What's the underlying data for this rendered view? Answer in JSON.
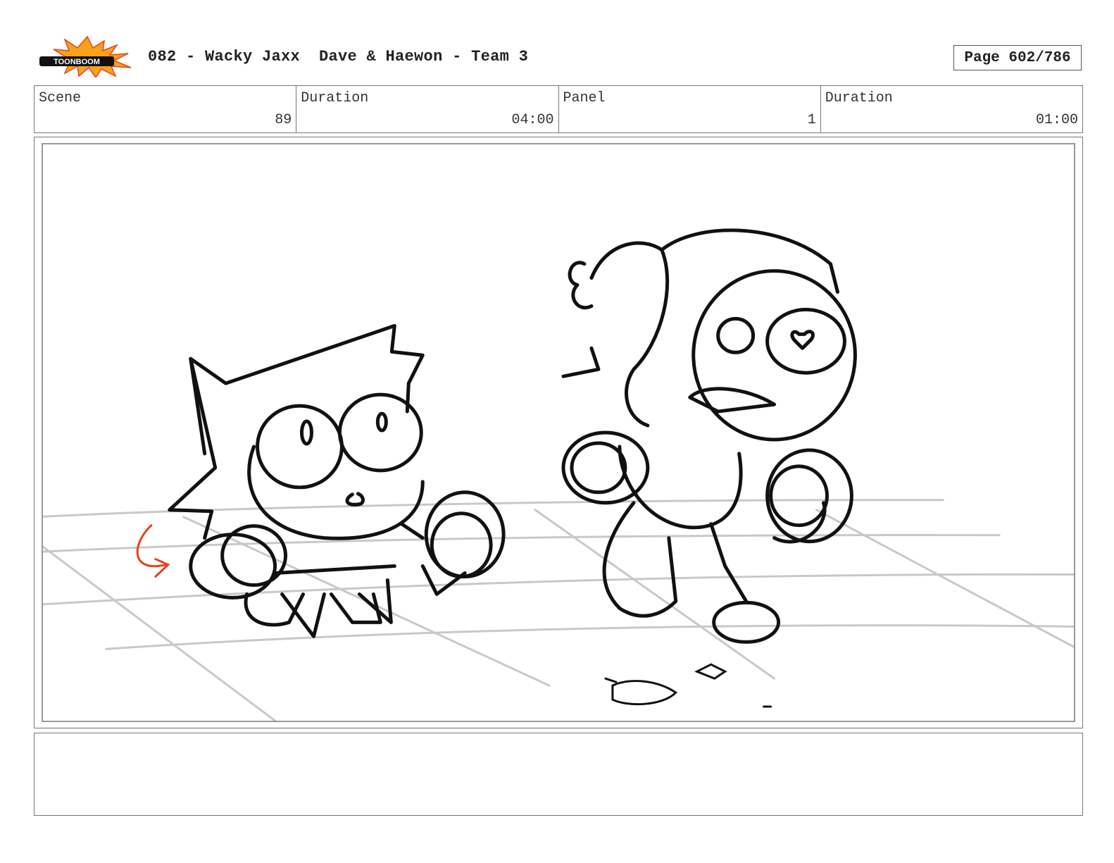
{
  "header": {
    "logo_text": "TOONBOOM",
    "title": "082 - Wacky Jaxx  Dave & Haewon - Team 3",
    "page": "Page 602/786"
  },
  "info": {
    "scene_label": "Scene",
    "scene_value": "89",
    "duration_label": "Duration",
    "duration_value": "04:00",
    "panel_label": "Panel",
    "panel_value": "1",
    "panel_duration_label": "Duration",
    "panel_duration_value": "01:00"
  },
  "colors": {
    "sketch": "#111111",
    "floor_grid": "#c8c8c8",
    "arrow": "#e8401c",
    "logo_burst": "#f7a21b"
  }
}
